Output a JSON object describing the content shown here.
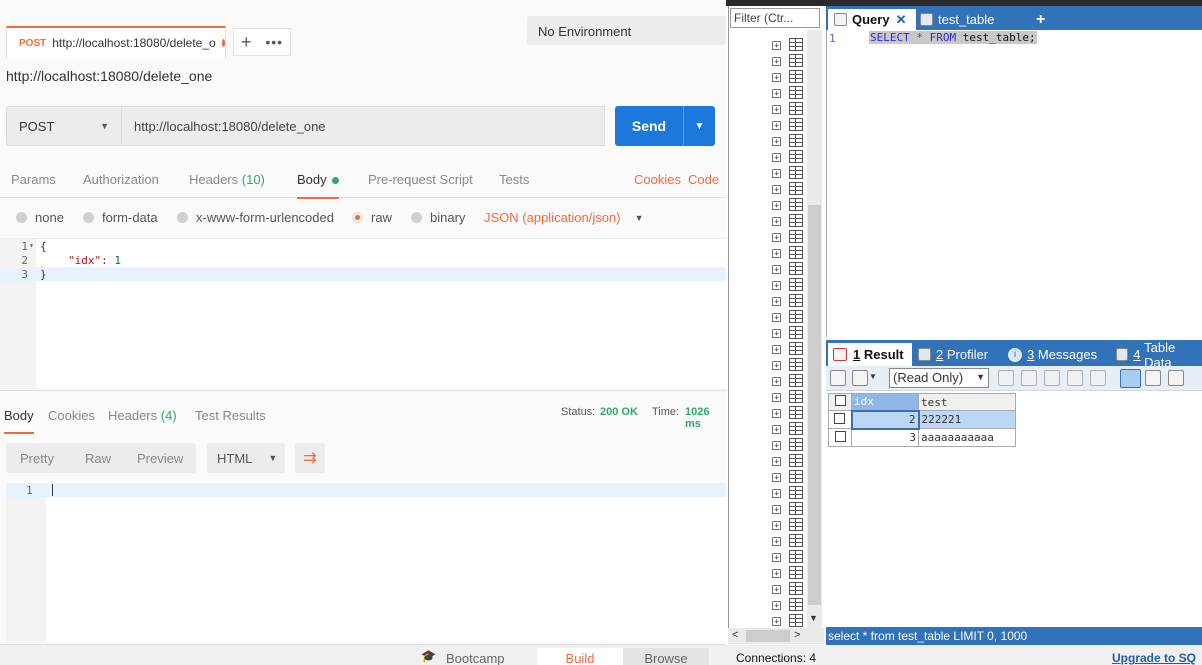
{
  "postman": {
    "tab": {
      "method": "POST",
      "url": "http://localhost:18080/delete_o"
    },
    "env": "No Environment",
    "request_title": "http://localhost:18080/delete_one",
    "method": "POST",
    "url": "http://localhost:18080/delete_one",
    "send": "Send",
    "req_tabs": {
      "params": "Params",
      "authorization": "Authorization",
      "headers": "Headers",
      "headers_count": "(10)",
      "body": "Body",
      "prerequest": "Pre-request Script",
      "tests": "Tests",
      "cookies": "Cookies",
      "code": "Code"
    },
    "body_types": {
      "none": "none",
      "form_data": "form-data",
      "urlencoded": "x-www-form-urlencoded",
      "raw": "raw",
      "binary": "binary",
      "json": "JSON (application/json)"
    },
    "editor": {
      "lines": [
        "1",
        "2",
        "3"
      ],
      "line1": "{",
      "key": "\"idx\"",
      "colon": ": ",
      "value": "1",
      "line3": "}"
    },
    "resp_tabs": {
      "body": "Body",
      "cookies": "Cookies",
      "headers": "Headers",
      "headers_count": "(4)",
      "test_results": "Test Results"
    },
    "status_label": "Status:",
    "status_value": "200 OK",
    "time_label": "Time:",
    "time_value": "1026 ms",
    "resp_buttons": {
      "pretty": "Pretty",
      "raw": "Raw",
      "preview": "Preview",
      "format": "HTML"
    },
    "resp_line": "1",
    "footer": {
      "bootcamp": "Bootcamp",
      "build": "Build",
      "browse": "Browse"
    }
  },
  "sqlyog": {
    "filter_placeholder": "Filter (Ctr...",
    "query_tab": "Query",
    "table_tab": "test_table",
    "query": {
      "line": "1",
      "select": "SELECT",
      "star": "*",
      "from": "FROM",
      "table": "test_table;"
    },
    "result_tabs": {
      "result_num": "1",
      "result": "Result",
      "profiler_num": "2",
      "profiler": "Profiler",
      "messages_num": "3",
      "messages": "Messages",
      "tabledata_num": "4",
      "tabledata": "Table Data"
    },
    "readonly": "(Read Only)",
    "grid": {
      "columns": [
        "idx",
        "test"
      ],
      "rows": [
        {
          "idx": "2",
          "test": "222221"
        },
        {
          "idx": "3",
          "test": "aaaaaaaaaaa"
        }
      ]
    },
    "status": "select * from test_table LIMIT 0, 1000",
    "connections": "Connections: 4",
    "upgrade": "Upgrade to SQ"
  }
}
